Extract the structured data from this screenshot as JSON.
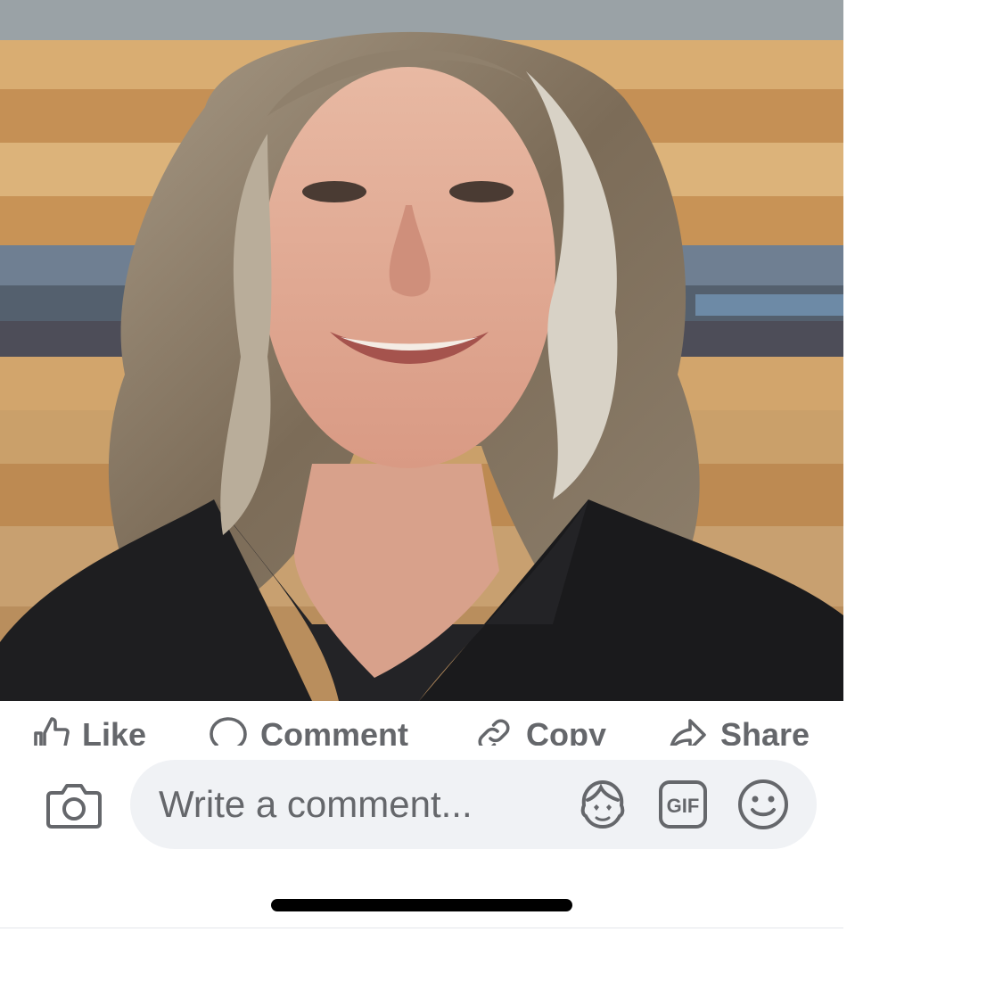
{
  "post": {
    "photo_icon": "woman-portrait-photo"
  },
  "actions": {
    "like_label": "Like",
    "comment_label": "Comment",
    "copy_label": "Copy",
    "share_label": "Share"
  },
  "composer": {
    "camera_icon": "camera-icon",
    "placeholder": "Write a comment...",
    "avatar_icon": "avatar-sticker-icon",
    "gif_label": "GIF",
    "emoji_icon": "smiley-icon"
  },
  "colors": {
    "icon_gray": "#65676b",
    "input_bg": "#f0f2f5",
    "home_indicator": "#000000"
  }
}
